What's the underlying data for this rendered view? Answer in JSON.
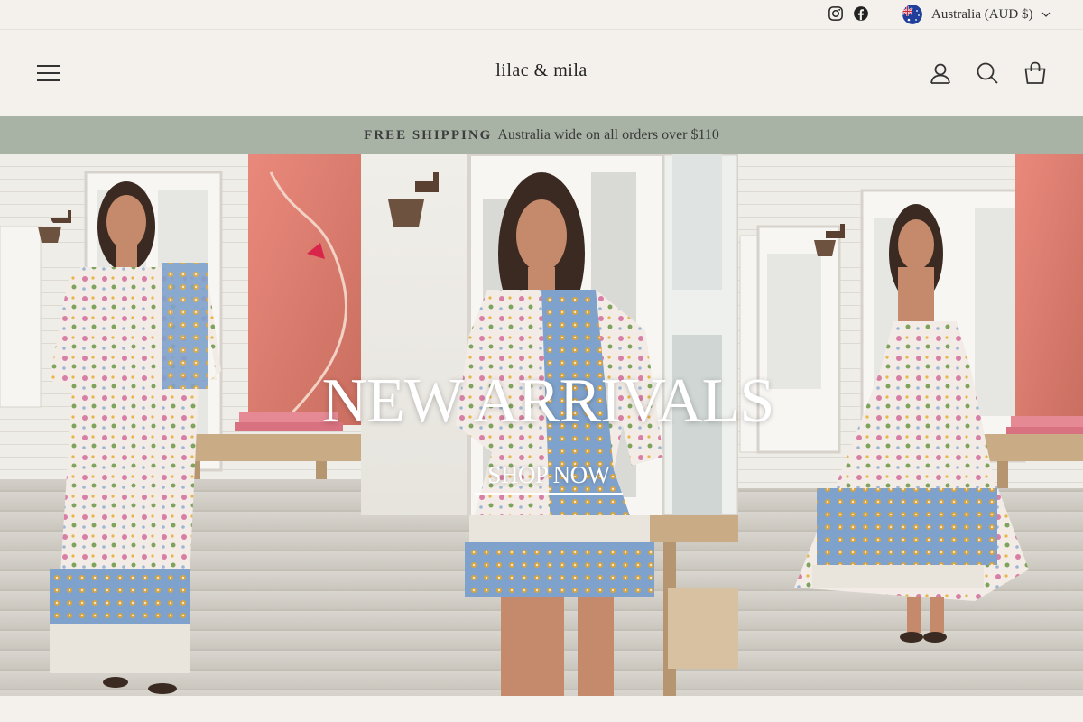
{
  "utility": {
    "social_icons": [
      "instagram-icon",
      "facebook-icon"
    ],
    "currency_flag": "australia-flag-icon",
    "currency_label": "Australia (AUD $)"
  },
  "header": {
    "logo": "lilac & mila",
    "icons": [
      "menu-icon",
      "account-icon",
      "search-icon",
      "cart-icon"
    ]
  },
  "announcement": {
    "bold": "FREE SHIPPING",
    "text": "Australia wide on all orders over $110"
  },
  "hero": {
    "title": "NEW ARRIVALS",
    "cta": "SHOP NOW"
  },
  "colors": {
    "background": "#f4f1ec",
    "announcement_bg": "#a8b3a5",
    "hero_text": "#ffffff"
  }
}
